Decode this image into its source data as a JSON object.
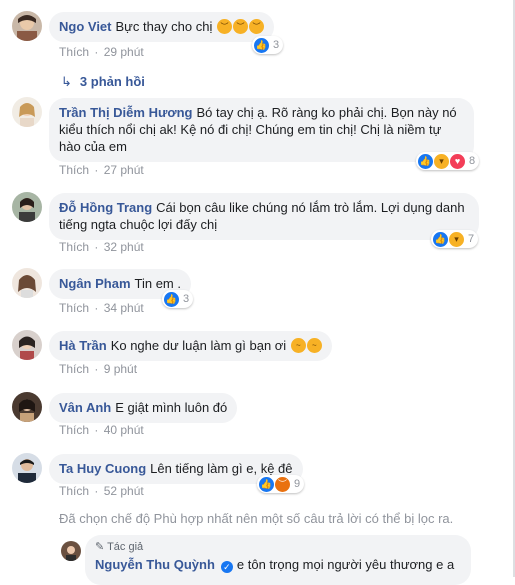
{
  "colors": {
    "name": "#385898",
    "bubble": "#f2f3f5",
    "meta": "#90949c",
    "like": "#1877f2"
  },
  "comments": [
    {
      "name": "Ngo Viet",
      "text": "Bực thay cho chị",
      "emojis": [
        "sad",
        "sad",
        "sad"
      ],
      "like": "Thích",
      "time": "29 phút",
      "reactions": [
        "like"
      ],
      "count": "3"
    },
    {
      "name": "Trần Thị Diễm Hương",
      "text": "Bó tay chị ạ. Rõ ràng ko phải chị. Bọn này nó kiểu thích nổi chị ak! Kệ nó đi chị! Chúng em tin chị! Chị là niềm tự hào của em",
      "like": "Thích",
      "time": "27 phút",
      "reactions": [
        "like",
        "haha",
        "love"
      ],
      "count": "8"
    },
    {
      "name": "Đỗ Hồng Trang",
      "text": "Cái bọn câu like chúng nó lắm trò lắm. Lợi dụng danh tiếng ngta chuộc lợi đấy chị",
      "like": "Thích",
      "time": "32 phút",
      "reactions": [
        "like",
        "haha"
      ],
      "count": "7"
    },
    {
      "name": "Ngân Pham",
      "text": "Tin em .",
      "like": "Thích",
      "time": "34 phút",
      "reactions": [
        "like"
      ],
      "count": "3"
    },
    {
      "name": "Hà Trần",
      "text": "Ko nghe dư luận làm gì bạn ơi",
      "emojis": [
        "sigh",
        "sigh"
      ],
      "like": "Thích",
      "time": "9 phút"
    },
    {
      "name": "Vân Anh",
      "text": "E giật mình luôn đó",
      "like": "Thích",
      "time": "40 phút"
    },
    {
      "name": "Ta Huy Cuong",
      "text": "Lên tiếng làm gì e, kệ đê",
      "like": "Thích",
      "time": "52 phút",
      "reactions": [
        "like",
        "angry"
      ],
      "count": "9"
    }
  ],
  "replies_link": "3 phản hồi",
  "filter_note": "Đã chọn chế độ Phù hợp nhất nên một số câu trả lời có thể bị lọc ra.",
  "author_reply": {
    "tag": "Tác giả",
    "name": "Nguyễn Thu Quỳnh",
    "text": "e tôn trọng mọi người yêu thương e a"
  },
  "separator": "·"
}
